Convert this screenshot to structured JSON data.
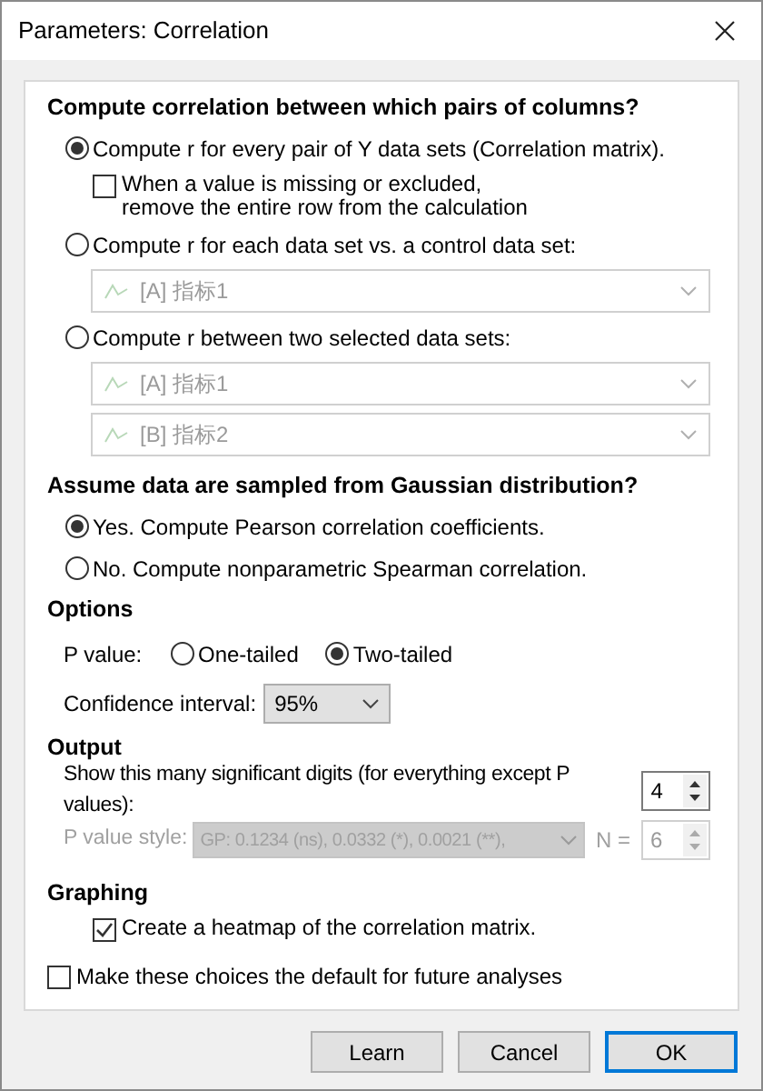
{
  "window": {
    "title": "Parameters: Correlation"
  },
  "pairs_section": {
    "heading": "Compute correlation between which pairs of columns?",
    "items": [
      {
        "kind": "radio",
        "label": "Compute r for every pair of Y data sets (Correlation matrix).",
        "selected": true
      },
      {
        "kind": "checkbox",
        "label": "When a value is missing or excluded, remove the entire row from the calculation",
        "checked": false
      },
      {
        "kind": "radio",
        "label": "Compute r for each data set vs. a control data set:",
        "selected": false
      },
      {
        "kind": "dropdown",
        "value": "[A] 指标1",
        "disabled": true
      },
      {
        "kind": "radio",
        "label": "Compute r between two selected data sets:",
        "selected": false
      },
      {
        "kind": "dropdown",
        "value": "[A] 指标1",
        "disabled": true
      },
      {
        "kind": "dropdown",
        "value": "[B] 指标2",
        "disabled": true
      }
    ]
  },
  "gaussian_section": {
    "heading": "Assume data are sampled from Gaussian distribution?",
    "items": [
      {
        "kind": "radio",
        "label": "Yes. Compute Pearson correlation coefficients.",
        "selected": true
      },
      {
        "kind": "radio",
        "label": "No. Compute nonparametric Spearman correlation.",
        "selected": false
      }
    ]
  },
  "options_section": {
    "heading": "Options",
    "p_value": {
      "label": "P value:",
      "choices": [
        {
          "label": "One-tailed",
          "selected": false
        },
        {
          "label": "Two-tailed",
          "selected": true
        }
      ]
    },
    "confidence_interval": {
      "label": "Confidence interval:",
      "value": "95%"
    }
  },
  "output_section": {
    "heading": "Output",
    "digits": {
      "label": "Show this many significant digits (for everything except P values):",
      "value": "4"
    },
    "p_value_style": {
      "label": "P value style:",
      "value": "GP: 0.1234 (ns), 0.0332 (*), 0.0021 (**),",
      "n_label": "N =",
      "n_value": "6",
      "disabled": true
    }
  },
  "graphing_section": {
    "heading": "Graphing",
    "items": [
      {
        "kind": "checkbox",
        "label": "Create a heatmap of the correlation matrix.",
        "checked": true
      }
    ]
  },
  "default_checkbox": {
    "label": "Make these choices the default for future analyses",
    "checked": false
  },
  "buttons": [
    {
      "label": "Learn",
      "default": false
    },
    {
      "label": "Cancel",
      "default": false
    },
    {
      "label": "OK",
      "default": true
    }
  ]
}
